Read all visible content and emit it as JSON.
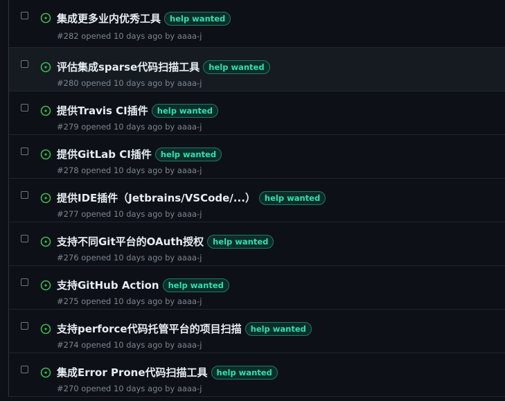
{
  "colors": {
    "background": "#0d1117",
    "row_hover": "#161b22",
    "open_icon": "#3fb950",
    "label_text": "#2fe0b4",
    "label_bg": "#0c2e28",
    "label_border": "#1f7a66",
    "title": "#e6edf3",
    "meta": "#7d8590"
  },
  "issues": [
    {
      "title": "集成更多业内优秀工具",
      "label": "help wanted",
      "meta": "#282 opened 10 days ago by aaaa-j",
      "hover": false
    },
    {
      "title": "评估集成sparse代码扫描工具",
      "label": "help wanted",
      "meta": "#280 opened 10 days ago by aaaa-j",
      "hover": true
    },
    {
      "title": "提供Travis CI插件",
      "label": "help wanted",
      "meta": "#279 opened 10 days ago by aaaa-j",
      "hover": false
    },
    {
      "title": "提供GitLab CI插件",
      "label": "help wanted",
      "meta": "#278 opened 10 days ago by aaaa-j",
      "hover": false
    },
    {
      "title": "提供IDE插件（Jetbrains/VSCode/...）",
      "label": "help wanted",
      "meta": "#277 opened 10 days ago by aaaa-j",
      "hover": false
    },
    {
      "title": "支持不同Git平台的OAuth授权",
      "label": "help wanted",
      "meta": "#276 opened 10 days ago by aaaa-j",
      "hover": false
    },
    {
      "title": "支持GitHub Action",
      "label": "help wanted",
      "meta": "#275 opened 10 days ago by aaaa-j",
      "hover": false
    },
    {
      "title": "支持perforce代码托管平台的项目扫描",
      "label": "help wanted",
      "meta": "#274 opened 10 days ago by aaaa-j",
      "hover": false
    },
    {
      "title": "集成Error Prone代码扫描工具",
      "label": "help wanted",
      "meta": "#270 opened 10 days ago by aaaa-j",
      "hover": false
    }
  ]
}
